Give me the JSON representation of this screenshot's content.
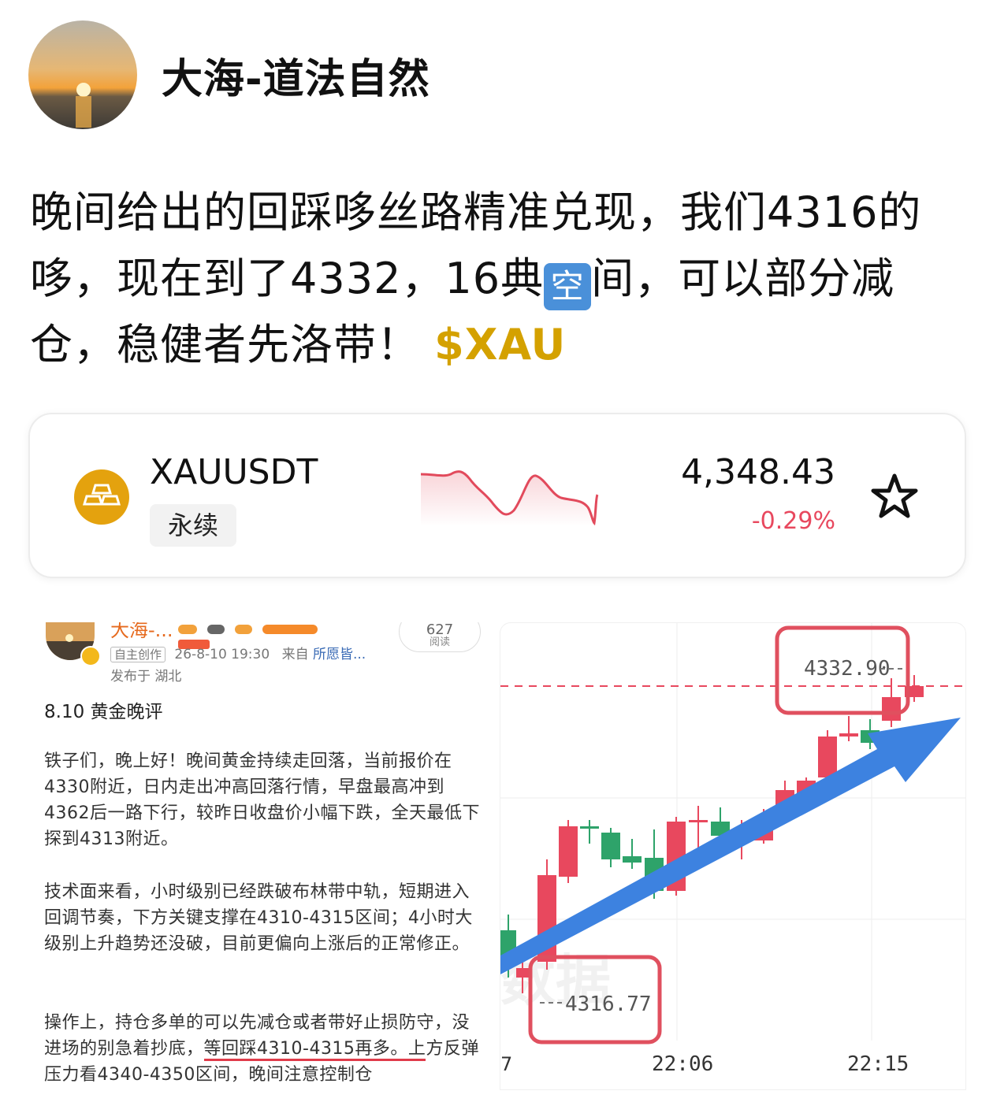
{
  "header": {
    "author_name": "大海-道法自然",
    "avatar_icon": "sunset-avatar-icon"
  },
  "post": {
    "text_part1": "晚间给出的回踩哆丝路精准兑现，我们4316的哆，现在到了4332，16典",
    "emoji": "空",
    "text_part2": "间，可以部分减仓，稳健者先洛带！",
    "ticker": "$XAU",
    "ticker_color": "#d4a100"
  },
  "quote_card": {
    "symbol": "XAUUSDT",
    "contract_type": "永续",
    "price": "4,348.43",
    "change": "-0.29%",
    "change_color": "#e8485e",
    "icon": "gold-bars-icon",
    "favorite_icon": "star-outline-icon"
  },
  "article_shot": {
    "author_name": "大海-...",
    "read_count": "627",
    "read_label": "阅读",
    "original_tag": "自主创作",
    "datetime": "26-8-10 19:30",
    "from_label": "来自",
    "from_source": "所愿皆...",
    "location": "发布于 湖北",
    "title": "8.10 黄金晚评",
    "para1": "铁子们，晚上好！晚间黄金持续走回落，当前报价在4330附近，日内走出冲高回落行情，早盘最高冲到4362后一路下行，较昨日收盘价小幅下跌，全天最低下探到4313附近。",
    "para2": "技术面来看，小时级别已经跌破布林带中轨，短期进入回调节奏，下方关键支撑在4310-4315区间；4小时大级别上升趋势还没破，目前更偏向上涨后的正常修正。",
    "para3_a": "操作上，持仓多单的可以先减仓或者带好止损防守，没进场的别急着抄底，",
    "para3_underlined": "等回踩4310-4315再多。上",
    "para3_b": "方反弹压力看4340-4350区间，晚间注意控制仓"
  },
  "chart_shot": {
    "high_label": "4332.90",
    "low_label": "4316.77",
    "time_labels": [
      "22:06",
      "22:15"
    ],
    "edge_label": "7",
    "watermark": "数据"
  }
}
